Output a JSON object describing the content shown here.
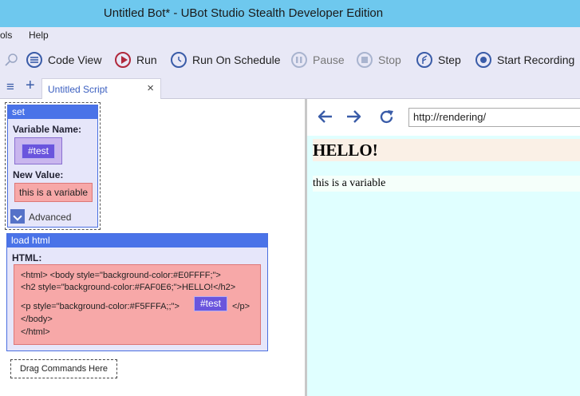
{
  "window": {
    "title": "Untitled Bot* - UBot Studio Stealth Developer Edition"
  },
  "menu": {
    "items": [
      "ols",
      "Help"
    ]
  },
  "toolbar": {
    "code_view": "Code View",
    "run": "Run",
    "run_on_schedule": "Run On Schedule",
    "pause": "Pause",
    "stop": "Stop",
    "step": "Step",
    "start_recording": "Start Recording"
  },
  "tabs": {
    "active_label": "Untitled Script",
    "close_glyph": "×",
    "add_glyph": "+",
    "menu_glyph": "≡"
  },
  "script": {
    "set_command": {
      "title": "set",
      "variable_name_label": "Variable Name:",
      "variable": "#test",
      "new_value_label": "New Value:",
      "new_value": "this is a variable",
      "advanced_label": "Advanced"
    },
    "load_html_command": {
      "title": "load html",
      "html_label": "HTML:",
      "lines": [
        "<html>  <body style=\"background-color:#E0FFFF;\">",
        "<h2 style=\"background-color:#FAF0E6;\">HELLO!</h2>",
        "<p style=\"background-color:#F5FFFA;;\">",
        "</p>",
        "</body>",
        "</html>"
      ],
      "variable": "#test"
    },
    "drag_placeholder": "Drag Commands Here"
  },
  "browser": {
    "url": "http://rendering/",
    "heading": "HELLO!",
    "paragraph": "this is a variable"
  },
  "colors": {
    "titlebar": "#6ec8ee",
    "chrome": "#e8e8f6",
    "command_header": "#4a73e8",
    "variable_chip": "#6a55dd",
    "value_box": "#f7a8a8",
    "page_bg": "#e0ffff",
    "h2_bg": "#faf0e6",
    "p_bg": "#f5fffa",
    "run_icon": "#b0283c",
    "nav_icon": "#3a5ca8"
  }
}
